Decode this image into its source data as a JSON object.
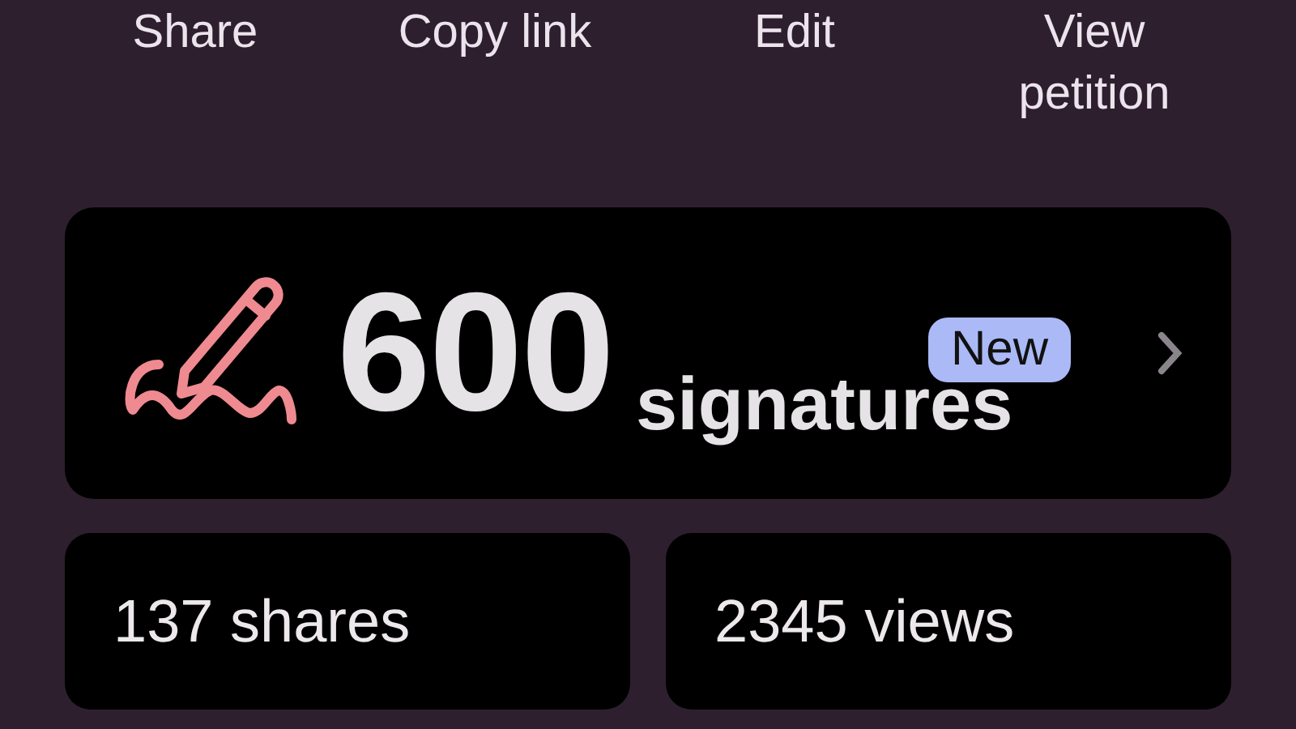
{
  "actions": [
    {
      "label": "Share"
    },
    {
      "label": "Copy link"
    },
    {
      "label": "Edit"
    },
    {
      "label": "View petition"
    }
  ],
  "signatures": {
    "count": "600",
    "unit": "signatures",
    "badge": "New"
  },
  "stats": [
    {
      "label": "137 shares"
    },
    {
      "label": "2345 views"
    }
  ]
}
